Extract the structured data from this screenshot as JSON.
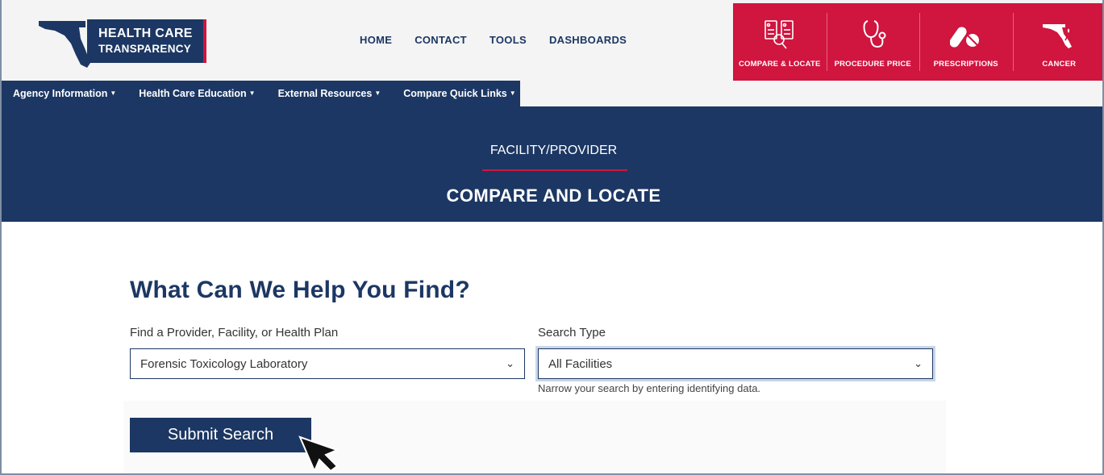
{
  "brand": {
    "line1": "HEALTH CARE",
    "line2": "TRANSPARENCY"
  },
  "top_nav": [
    "HOME",
    "CONTACT",
    "TOOLS",
    "DASHBOARDS"
  ],
  "tools": [
    {
      "label": "COMPARE & LOCATE",
      "icon": "compare-locate-icon"
    },
    {
      "label": "PROCEDURE PRICE",
      "icon": "stethoscope-icon"
    },
    {
      "label": "PRESCRIPTIONS",
      "icon": "pills-icon"
    },
    {
      "label": "CANCER",
      "icon": "cancer-ribbon-icon"
    }
  ],
  "sub_nav": [
    "Agency Information",
    "Health Care Education",
    "External Resources",
    "Compare Quick Links"
  ],
  "hero": {
    "eyebrow": "FACILITY/PROVIDER",
    "title": "COMPARE AND LOCATE"
  },
  "search": {
    "heading": "What Can We Help You Find?",
    "provider_label": "Find a Provider, Facility, or Health Plan",
    "provider_value": "Forensic Toxicology Laboratory",
    "type_label": "Search Type",
    "type_value": "All Facilities",
    "help_text": "Narrow your search by entering identifying data.",
    "submit_label": "Submit Search"
  },
  "colors": {
    "navy": "#1c3763",
    "red": "#d0153f",
    "header_bg": "#f4f4f4"
  }
}
